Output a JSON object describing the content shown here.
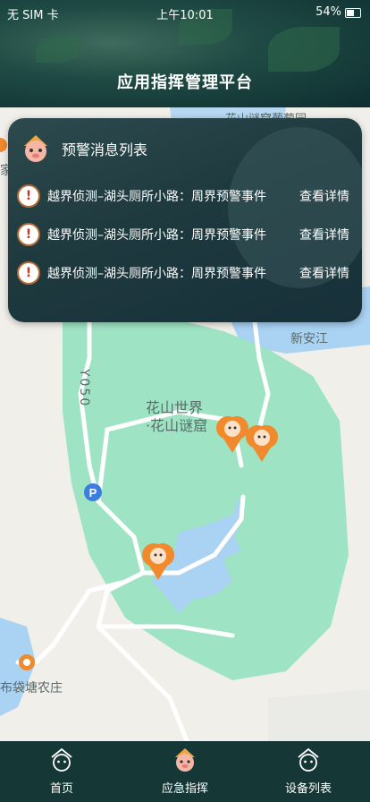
{
  "status_bar": {
    "carrier": "无 SIM 卡",
    "time": "上午10:01",
    "battery": "54%"
  },
  "header": {
    "title": "应用指挥管理平台"
  },
  "panel": {
    "title": "预警消息列表",
    "alerts": [
      {
        "text": "越界侦测–湖头厕所小路：周界预警事件",
        "action": "查看详情"
      },
      {
        "text": "越界侦测–湖头厕所小路：周界预警事件",
        "action": "查看详情"
      },
      {
        "text": "越界侦测–湖头厕所小路：周界预警事件",
        "action": "查看详情"
      }
    ]
  },
  "map": {
    "labels": {
      "garden": "花山谜窟葡萄园",
      "river": "新安江",
      "road": "Y050",
      "park_line1": "花山世界",
      "park_line2": "·花山谜窟",
      "village": "布袋塘农庄",
      "edge": "家"
    },
    "colors": {
      "park": "#9fe3c5",
      "water": "#a9d2f3",
      "marker": "#f08a2c",
      "parking": "#3b7de1"
    }
  },
  "tabs": [
    {
      "label": "首页",
      "icon": "home-icon"
    },
    {
      "label": "应急指挥",
      "icon": "command-icon"
    },
    {
      "label": "设备列表",
      "icon": "device-list-icon"
    }
  ]
}
